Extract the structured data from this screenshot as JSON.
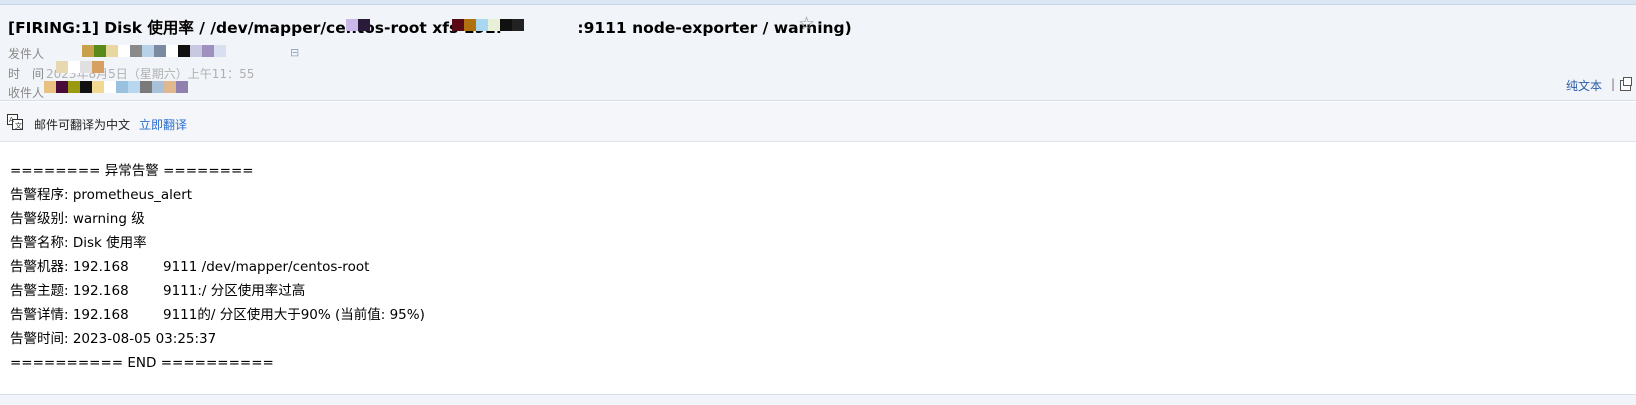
{
  "email": {
    "subject": "[FIRING:1] Disk 使用率 / /dev/mapper/centos-root xfs 192.              :9111 node-exporter / warning)",
    "sender_label": "发件人",
    "time_label": "时　间",
    "time_value": "2023年8月5日（星期六）上午11：55",
    "recipient_label": "收件人",
    "plain_text_link": "纯文本",
    "separator": "|"
  },
  "translate": {
    "notice": "邮件可翻译为中文",
    "action": "立即翻译"
  },
  "body_lines": [
    "======== 异常告警 ========",
    "告警程序: prometheus_alert",
    "告警级别: warning 级",
    "告警名称: Disk 使用率",
    "告警机器: 192.168        9111 /dev/mapper/centos-root",
    "告警主题: 192.168        9111:/ 分区使用率过高",
    "告警详情: 192.168        9111的/ 分区使用大于90% (当前值: 95%)",
    "告警时间: 2023-08-05 03:25:37",
    "========== END =========="
  ]
}
